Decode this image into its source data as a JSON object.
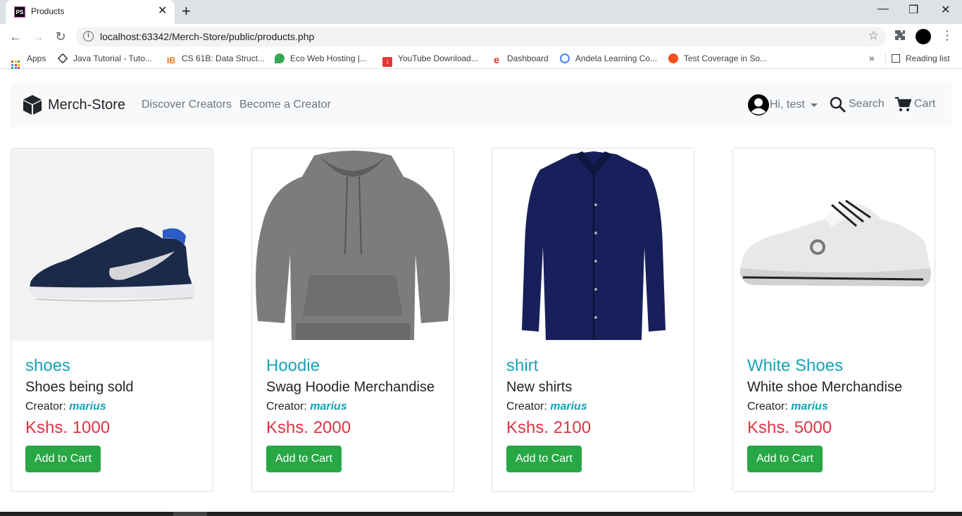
{
  "browser": {
    "tab_title": "Products",
    "url": "localhost:63342/Merch-Store/public/products.php",
    "bookmarks": [
      {
        "label": "Apps"
      },
      {
        "label": "Java Tutorial - Tuto..."
      },
      {
        "label": "CS 61B: Data Struct..."
      },
      {
        "label": "Eco Web Hosting |..."
      },
      {
        "label": "YouTube Download..."
      },
      {
        "label": "Dashboard"
      },
      {
        "label": "Andela Learning Co..."
      },
      {
        "label": "Test Coverage in So..."
      }
    ],
    "more": "»",
    "reading_list": "Reading list"
  },
  "navbar": {
    "brand": "Merch-Store",
    "links": [
      "Discover Creators",
      "Become a Creator"
    ],
    "user_greeting": "Hi, test",
    "search": "Search",
    "cart": "Cart"
  },
  "products": [
    {
      "name": "shoes",
      "description": "Shoes being sold",
      "creator_label": "Creator:",
      "creator": "marius",
      "price": "Kshs. 1000",
      "button": "Add to Cart"
    },
    {
      "name": "Hoodie",
      "description": "Swag Hoodie Merchandise",
      "creator_label": "Creator:",
      "creator": "marius",
      "price": "Kshs. 2000",
      "button": "Add to Cart"
    },
    {
      "name": "shirt",
      "description": "New shirts",
      "creator_label": "Creator:",
      "creator": "marius",
      "price": "Kshs. 2100",
      "button": "Add to Cart"
    },
    {
      "name": "White Shoes",
      "description": "White shoe Merchandise",
      "creator_label": "Creator:",
      "creator": "marius",
      "price": "Kshs. 5000",
      "button": "Add to Cart"
    }
  ],
  "colors": {
    "name": "#17a2b8",
    "price": "#dc3545",
    "button": "#28a745",
    "navbar_bg": "#f8f9fa"
  }
}
